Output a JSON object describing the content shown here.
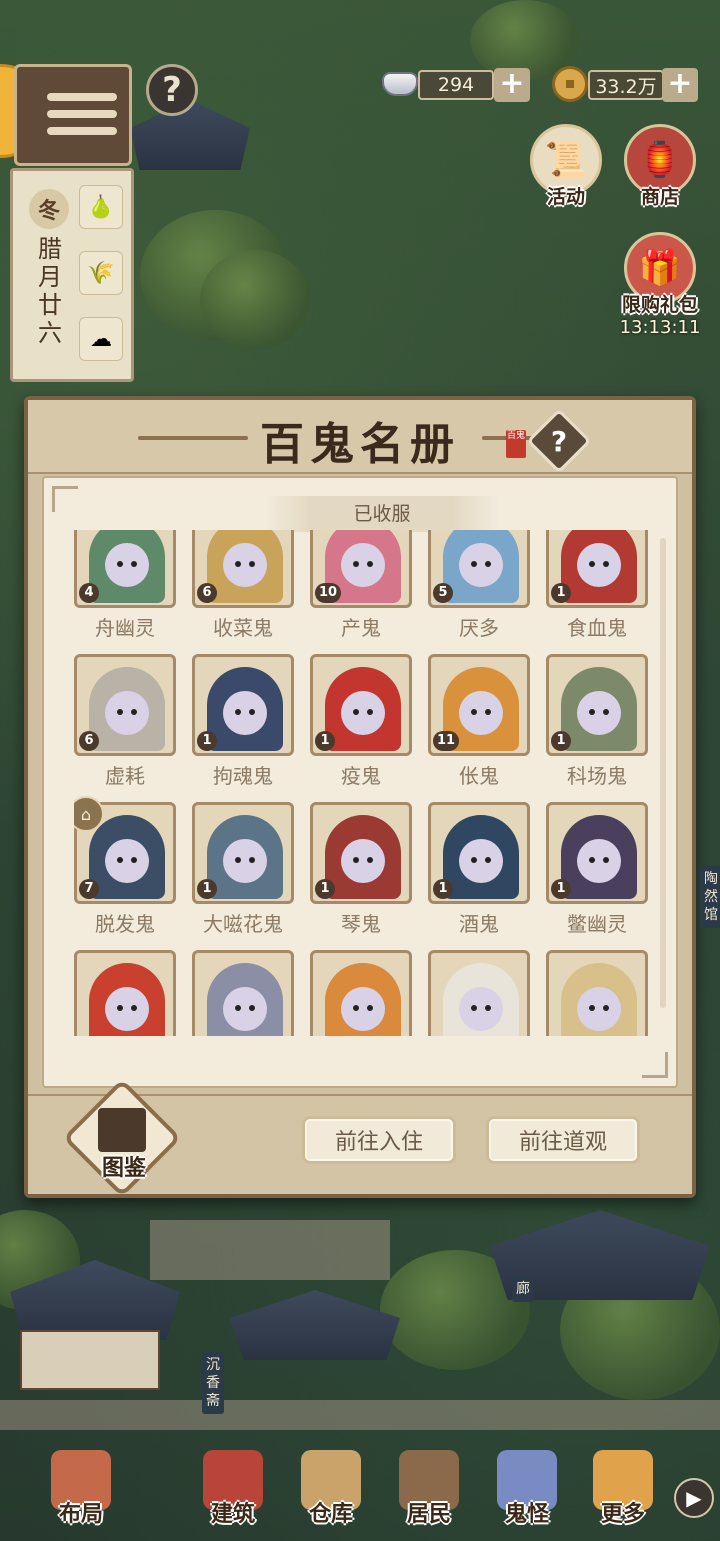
{
  "hud": {
    "help_symbol": "?",
    "calendar": {
      "season": "冬",
      "date": "腊月廿六",
      "icons": [
        "pear-icon",
        "wheat-icon",
        "cloud-icon"
      ]
    },
    "currencies": [
      {
        "name": "silver-ingot",
        "value": "294",
        "plus": "+"
      },
      {
        "name": "copper-coin",
        "value": "33.2万",
        "plus": "+"
      }
    ],
    "features": [
      {
        "label": "活动",
        "icon": "activity-scroll-icon"
      },
      {
        "label": "商店",
        "icon": "shop-icon"
      },
      {
        "label": "限购礼包",
        "icon": "gift-bag-icon",
        "timer": "13:13:11"
      }
    ]
  },
  "dialog": {
    "title": "百鬼名册",
    "seal_text": "百鬼",
    "help_symbol": "?",
    "section_label": "已收服",
    "ghosts": [
      {
        "name": "舟幽灵",
        "count": "4",
        "color": "#5e8a6a"
      },
      {
        "name": "收菜鬼",
        "count": "6",
        "color": "#c9a35a"
      },
      {
        "name": "产鬼",
        "count": "10",
        "color": "#d6768a"
      },
      {
        "name": "厌多",
        "count": "5",
        "color": "#7aa6c9"
      },
      {
        "name": "食血鬼",
        "count": "1",
        "color": "#b23a33"
      },
      {
        "name": "虚耗",
        "count": "6",
        "color": "#b9b2a6"
      },
      {
        "name": "拘魂鬼",
        "count": "1",
        "color": "#3b4a6b"
      },
      {
        "name": "疫鬼",
        "count": "1",
        "color": "#c2362f"
      },
      {
        "name": "伥鬼",
        "count": "11",
        "color": "#d9913b"
      },
      {
        "name": "科场鬼",
        "count": "1",
        "color": "#7d8a6a"
      },
      {
        "name": "脱发鬼",
        "count": "7",
        "color": "#3c4e66",
        "pavilion": true
      },
      {
        "name": "大嗞花鬼",
        "count": "1",
        "color": "#5b7487"
      },
      {
        "name": "琴鬼",
        "count": "1",
        "color": "#9a3a33"
      },
      {
        "name": "酒鬼",
        "count": "1",
        "color": "#2f4760"
      },
      {
        "name": "鳖幽灵",
        "count": "1",
        "color": "#4a3f5c"
      },
      {
        "name": "",
        "count": "",
        "color": "#c9402e"
      },
      {
        "name": "",
        "count": "",
        "color": "#8b8fa6"
      },
      {
        "name": "",
        "count": "",
        "color": "#d98a3c"
      },
      {
        "name": "",
        "count": "",
        "color": "#e9e4da"
      },
      {
        "name": "",
        "count": "",
        "color": "#d7c08a"
      }
    ],
    "tujian_label": "图鉴",
    "buttons": {
      "checkin": "前往入住",
      "temple": "前往道观"
    }
  },
  "signs": {
    "right": "陶然馆",
    "left": "沉香斋",
    "mid": "廊"
  },
  "nav": {
    "items": [
      {
        "label": "布局",
        "color": "#c46a4a"
      },
      {
        "label": "建筑",
        "color": "#b8443a"
      },
      {
        "label": "仓库",
        "color": "#c9a36a"
      },
      {
        "label": "居民",
        "color": "#8a6a4a"
      },
      {
        "label": "鬼怪",
        "color": "#7a8ac2"
      },
      {
        "label": "更多",
        "color": "#e0a24a"
      }
    ],
    "arrow": "▶"
  },
  "colors": {
    "accent": "#7b6244",
    "panel": "#f3ecdd",
    "text_muted": "#8c7a64"
  }
}
